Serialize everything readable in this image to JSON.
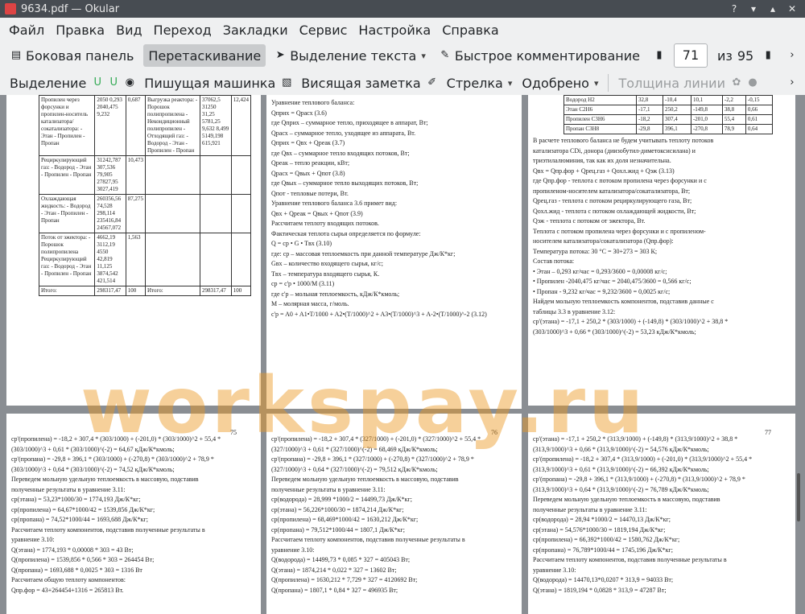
{
  "window": {
    "title": "9634.pdf — Okular"
  },
  "menu": [
    "Файл",
    "Правка",
    "Вид",
    "Переход",
    "Закладки",
    "Сервис",
    "Настройка",
    "Справка"
  ],
  "toolbar1": {
    "sidebar": "Боковая панель",
    "drag": "Перетаскивание",
    "text_select": "Выделение текста",
    "quick_comment": "Быстрое комментирование",
    "page_current": "71",
    "page_of": "из",
    "page_total": "95"
  },
  "toolbar2": {
    "select": "Выделение",
    "typewriter": "Пишущая машинка",
    "sticky": "Висящая заметка",
    "arrow": "Стрелка",
    "approved": "Одобрено",
    "line_width": "Толщина линии"
  },
  "watermark": "workspay.ru",
  "page_left_top": {
    "rows": [
      [
        "Пропилен через форсунки и пропилен-носитель катализатора/сокатализатора: - Этан - Пропилен - Пропан",
        "2050 0,293 2040,475 9,232",
        "0,687",
        "Выгрузка реактора: - Порошок полипропилена - Некондиционный полипропилен - Отходящий газ: - Водород - Этан - Пропилен - Пропан",
        "37062,5 31250 31,25 5781,25 9,632 8,499 5149,198 615,921",
        "12,424"
      ],
      [
        "Рециркулирующий газ: - Водород - Этан - Пропилен - Пропан",
        "31242,787 307,536 79,905 27827,95 3027,419",
        "10,473",
        "",
        "",
        ""
      ],
      [
        "Охлаждающая жидкость: - Водород - Этан - Пропилен - Пропан",
        "260356,56 74,528 298,114 235416,84 24567,072",
        "87,275",
        "",
        "",
        ""
      ],
      [
        "Поток от эжектора: - Порошок полипропилена Рециркулирующий газ: - Водород - Этан - Пропилен - Пропан",
        "4662,19 3112,19 4550 42,819 11,125 3874,542 421,514",
        "1,563",
        "",
        "",
        ""
      ],
      [
        "Итого:",
        "298317,47",
        "100",
        "Итого:",
        "298317,47",
        "100"
      ]
    ]
  },
  "page_mid_top": [
    "Уравнение теплового баланса:",
    "Qприх = Qрасх   (3.6)",
    "где Qприх – суммарное тепло, приходящее в аппарат, Вт;",
    "Qрасх – суммарное тепло, уходящее из аппарата, Вт.",
    "Qприх = Qвх + Qреак   (3.7)",
    "где Qвх – суммарное тепло входящих потоков, Вт;",
    "Qреак – тепло реакции, кВт;",
    "Qрасх = Qвых + Qпот   (3.8)",
    "где Qвых – суммарное тепло выходящих потоков, Вт;",
    "Qпот - тепловые потери, Вт.",
    "Уравнение теплового баланса 3.6 примет вид:",
    "Qвх + Qреак = Qвых + Qпот   (3.9)",
    "Рассчитаем теплоту входящих потоков.",
    "Фактическая теплота сырья определяется по формуле:",
    "Q = cp • G • Tвх   (3.10)",
    "где: cp – массовая теплоемкость при данной температуре Дж/К*кг;",
    "Gвх – количество входящего сырья, кг/с;",
    "Tвх – температура входящего сырья, К.",
    "cp = c'p • 1000/M   (3.11)",
    "где c'p – мольная теплоемкость, кДж/К*кмоль;",
    "M – молярная масса, г/моль.",
    "c'p = A0 + A1•T/1000 + A2•(T/1000)^2 + A3•(T/1000)^3 + A-2•(T/1000)^-2   (3.12)"
  ],
  "page_right_top": {
    "table": [
      [
        "Водород H2",
        "32,8",
        "-10,4",
        "10,1",
        "-2,2",
        "-0,15"
      ],
      [
        "Этан C2H6",
        "-17,1",
        "250,2",
        "-149,8",
        "38,8",
        "0,66"
      ],
      [
        "Пропилен C3H6",
        "-18,2",
        "307,4",
        "-201,0",
        "55,4",
        "0,61"
      ],
      [
        "Пропан C3H8",
        "-29,8",
        "396,1",
        "-270,8",
        "78,9",
        "0,64"
      ]
    ],
    "lines": [
      "В расчете теплового баланса не будем учитывать теплоту потоков",
      "катализатора CDi, донора (диизобутил-диметоксисилана) и",
      "триэтилалюминия, так как их доля незначительна.",
      "Qвх = Qпр.фор + Qрец.газ + Qохл.жид + Qэж   (3.13)",
      "где Qпр.фор - теплота с потоком пропилена через форсунки и с",
      "пропиленом-носителем катализатора/сокатализатора, Вт;",
      "Qрец.газ - теплота с потоком рециркулирующего газа, Вт;",
      "Qохл.жид - теплота с потоком охлаждающей жидкости, Вт;",
      "Qэж - теплота с потоком от эжектора, Вт.",
      "Теплота с потоком пропилена через форсунки и с пропиленом-",
      "носителем катализатора/сокатализатора (Qпр.фор):",
      "Температура потока: 30 °С = 30+273 = 303 К;",
      "Состав потока:",
      "• Этан – 0,293 кг/час = 0,293/3600 = 0,00008 кг/с;",
      "• Пропилен -2040,475 кг/час = 2040,475/3600 = 0,566 кг/с;",
      "• Пропан - 9,232 кг/час = 9,232/3600 = 0,0025 кг/с;",
      "Найдем мольную теплоемкость компонентов, подставив данные с",
      "таблицы 3.3 в уравнение 3.12:",
      "cp'(этана) = -17,1 + 250,2 * (303/1000) + (-149,8) * (303/1000)^2 + 38,8 *",
      "(303/1000)^3 + 0,66 * (303/1000)^(-2) = 53,23 кДж/К*кмоль;"
    ]
  },
  "page_75": {
    "num": "75",
    "lines": [
      "cp'(пропилена) = -18,2 + 307,4 * (303/1000) + (-201,0) * (303/1000)^2 + 55,4 *",
      "(303/1000)^3 + 0,61 * (303/1000)^(-2) = 64,67 кДж/К*кмоль;",
      "cp'(пропана) = -29,8 + 396,1 * (303/1000) + (-270,8) * (303/1000)^2 + 78,9 *",
      "(303/1000)^3 + 0,64 * (303/1000)^(-2) = 74,52 кДж/К*кмоль;",
      "Переведем мольную удельную теплоемкость в массовую, подставив",
      "полученные результаты в уравнение 3.11:",
      "cp(этана) = 53,23*1000/30 = 1774,193 Дж/К*кг;",
      "cp(пропилена) = 64,67*1000/42 = 1539,856 Дж/К*кг;",
      "cp(пропана) = 74,52*1000/44 = 1693,688 Дж/К*кг;",
      "Рассчитаем теплоту компонентов, подставив полученные результаты в",
      "уравнение 3.10:",
      "Q(этана) = 1774,193 * 0,00008 * 303 = 43 Вт;",
      "Q(пропилена) = 1539,856 * 0,566 * 303 = 264454 Вт;",
      "Q(пропана) = 1693,688 * 0,0025 * 303 = 1316 Вт",
      "Рассчитаем общую теплоту компонентов:",
      "Qпр.фор = 43+264454+1316 = 265813 Вт."
    ]
  },
  "page_76": {
    "num": "76",
    "lines": [
      "cp'(пропилена) = -18,2 + 307,4 * (327/1000) + (-201,0) * (327/1000)^2 + 55,4 *",
      "(327/1000)^3 + 0,61 * (327/1000)^(-2) = 68,469 кДж/К*кмоль;",
      "cp'(пропана) = -29,8 + 396,1 * (327/1000) + (-270,8) * (327/1000)^2 + 78,9 *",
      "(327/1000)^3 + 0,64 * (327/1000)^(-2) = 79,512 кДж/К*кмоль;",
      "Переведем мольную удельную теплоемкость в массовую, подставив",
      "полученные результаты в уравнение 3.11:",
      "cp(водорода) = 28,999 *1000/2 = 14499,73 Дж/К*кг;",
      "cp(этана) = 56,226*1000/30 = 1874,214 Дж/К*кг;",
      "cp(пропилена) = 68,469*1000/42 = 1630,212 Дж/К*кг;",
      "cp(пропана) = 79,512*1000/44 = 1807,1 Дж/К*кг;",
      "Рассчитаем теплоту компонентов, подставив полученные результаты в",
      "уравнение 3.10:",
      "Q(водорода) = 14499,73 * 0,085 * 327 = 405043 Вт;",
      "Q(этана) = 1874,214 * 0,022 * 327 = 13602 Вт;",
      "Q(пропилена) = 1630,212 * 7,729 * 327 = 4120692 Вт;",
      "Q(пропана) = 1807,1 * 0,84 * 327 = 496935 Вт;"
    ]
  },
  "page_77": {
    "num": "77",
    "lines": [
      "cp'(этана) = -17,1 + 250,2 * (313,9/1000) + (-149,8) * (313,9/1000)^2 + 38,8 *",
      "(313,9/1000)^3 + 0,66 * (313,9/1000)^(-2) = 54,576 кДж/К*кмоль;",
      "cp'(пропилена) = -18,2 + 307,4 * (313,9/1000) + (-201,0) * (313,9/1000)^2 + 55,4 *",
      "(313,9/1000)^3 + 0,61 * (313,9/1000)^(-2) = 66,392 кДж/К*кмоль;",
      "cp'(пропана) = -29,8 + 396,1 * (313,9/1000) + (-270,8) * (313,9/1000)^2 + 78,9 *",
      "(313,9/1000)^3 + 0,64 * (313,9/1000)^(-2) = 76,789 кДж/К*кмоль;",
      "Переведем мольную удельную теплоемкость в массовую, подставив",
      "полученные результаты в уравнение 3.11:",
      "cp(водорода) = 28,94 *1000/2 = 14470,13 Дж/К*кг;",
      "cp(этана) = 54,576*1000/30 = 1819,194 Дж/К*кг;",
      "cp(пропилена) = 66,392*1000/42 = 1580,762 Дж/К*кг;",
      "cp(пропана) = 76,789*1000/44 = 1745,196 Дж/К*кг;",
      "Рассчитаем теплоту компонентов, подставив полученные результаты в",
      "уравнение 3.10:",
      "Q(водорода) = 14470,13*0,0207 * 313,9 = 94033 Вт;",
      "Q(этана) = 1819,194 * 0,0828 * 313,9 = 47287 Вт;"
    ]
  }
}
